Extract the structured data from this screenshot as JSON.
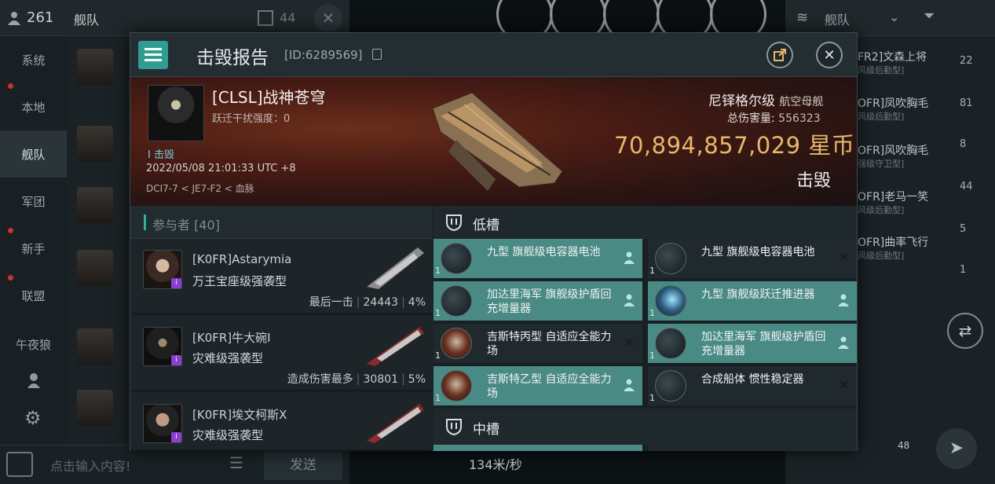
{
  "background": {
    "top_left": {
      "member_count": "261",
      "channel": "舰队",
      "unread": "44"
    },
    "side_tabs": [
      "系统",
      "本地",
      "舰队",
      "军团",
      "新手",
      "联盟",
      "午夜狼"
    ],
    "chat_input_placeholder": "点击输入内容!",
    "send_label": "发送",
    "speed": "134米/秒",
    "right_panel": {
      "title": "舰队",
      "members": [
        {
          "name": "FR2]文森上将",
          "role": "风级后勤型]"
        },
        {
          "name": "OFR]凤吹胸毛",
          "role": "风级后勤型]"
        },
        {
          "name": "OFR]风吹胸毛",
          "role": "强级守卫型]"
        },
        {
          "name": "OFR]老马一笑",
          "role": "风级后勤型]"
        },
        {
          "name": "OFR]曲率飞行",
          "role": "风级后勤型]"
        }
      ],
      "counts": [
        "22",
        "81",
        "8",
        "44",
        "5",
        "1"
      ],
      "drone_count": "48"
    }
  },
  "modal": {
    "title": "击毁报告",
    "id_text": "[ID:6289569]",
    "victim": {
      "name": "[CLSL]战神苍穹",
      "warp_disrupt": "跃迁干扰强度：0",
      "role": "I 击毁",
      "time": "2022/05/08 21:01:33 UTC +8",
      "location": "DCI7-7 < JE7-F2 < 血脉",
      "ship_class": "尼铎格尔级",
      "ship_class_sub": "航空母舰",
      "damage_label": "总伤害量:",
      "damage_value": "556323",
      "isk_value": "70,894,857,029",
      "isk_unit": "星币",
      "status": "击毁"
    },
    "participants": {
      "title": "参与者 [40]",
      "rows": [
        {
          "name": "[K0FR]Astarymia",
          "ship": "万王宝座级强袭型",
          "tag": "最后一击",
          "damage": "24443",
          "percent": "4%"
        },
        {
          "name": "[K0FR]牛大碗I",
          "ship": "灾难级强袭型",
          "tag": "造成伤害最多",
          "damage": "30801",
          "percent": "5%"
        },
        {
          "name": "[K0FR]埃文柯斯X",
          "ship": "灾难级强袭型",
          "tag": "",
          "damage": "",
          "percent": ""
        }
      ]
    },
    "slots": {
      "low_title": "低槽",
      "mid_title": "中槽",
      "low_modules": [
        {
          "name": "九型 旗舰级电容器电池",
          "qty": "1",
          "fitted": true
        },
        {
          "name": "九型 旗舰级电容器电池",
          "qty": "1",
          "fitted": false
        },
        {
          "name": "加达里海军 旗舰级护盾回充增量器",
          "qty": "1",
          "fitted": true
        },
        {
          "name": "九型 旗舰级跃迁推进器",
          "qty": "1",
          "fitted": true
        },
        {
          "name": "吉斯特丙型 自适应全能力场",
          "qty": "1",
          "fitted": false
        },
        {
          "name": "加达里海军 旗舰级护盾回充增量器",
          "qty": "1",
          "fitted": true
        },
        {
          "name": "吉斯特乙型 自适应全能力场",
          "qty": "1",
          "fitted": true
        },
        {
          "name": "合成船体 惯性稳定器",
          "qty": "1",
          "fitted": false
        }
      ]
    }
  }
}
